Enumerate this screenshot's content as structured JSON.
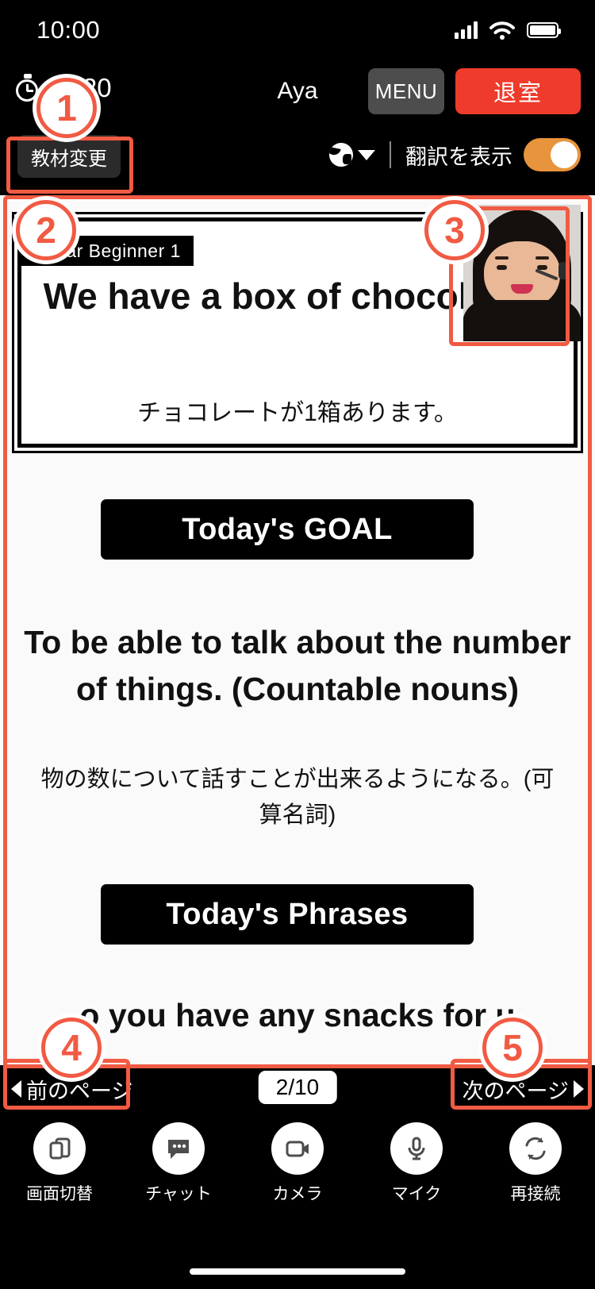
{
  "statusbar": {
    "time": "10:00",
    "signal_icon": "cellular-bars-icon",
    "wifi_icon": "wifi-icon",
    "battery_icon": "battery-icon"
  },
  "header": {
    "timer_text": "19:20",
    "timer_icon": "stopwatch-icon",
    "teacher_name": "Aya",
    "menu_label": "MENU",
    "exit_label": "退室"
  },
  "subheader": {
    "material_change_label": "教材変更",
    "globe_icon": "globe-icon",
    "caret_icon": "chevron-down-icon",
    "translation_label": "翻訳を表示",
    "translation_on": true,
    "toggle_color": "#e8943c"
  },
  "material": {
    "slide_tag": "mmar Beginner 1",
    "slide_en": "We have a box of chocolates.",
    "slide_ja": "チョコレートが1箱あります。",
    "goal_badge": "Today's GOAL",
    "goal_en": "To be able to talk about the number of things. (Countable nouns)",
    "goal_ja": "物の数について話すことが出来るようになる。(可算名詞)",
    "phrases_badge": "Today's Phrases",
    "phrase_line": "o you have any snacks for u",
    "teacher_video_name": "teacher-video-thumbnail"
  },
  "pagenav": {
    "prev_label": "前のページ",
    "next_label": "次のページ",
    "page_indicator": "2/10"
  },
  "toolbar": [
    {
      "label": "画面切替",
      "icon": "screen-switch-icon"
    },
    {
      "label": "チャット",
      "icon": "chat-icon"
    },
    {
      "label": "カメラ",
      "icon": "camera-icon"
    },
    {
      "label": "マイク",
      "icon": "microphone-icon"
    },
    {
      "label": "再接続",
      "icon": "reconnect-icon"
    }
  ],
  "annotations": {
    "accent_color": "#f15a43",
    "markers": [
      {
        "number": "①"
      },
      {
        "number": "②"
      },
      {
        "number": "③"
      },
      {
        "number": "④"
      },
      {
        "number": "⑤"
      }
    ],
    "marker_1": "1",
    "marker_2": "2",
    "marker_3": "3",
    "marker_4": "4",
    "marker_5": "5"
  }
}
